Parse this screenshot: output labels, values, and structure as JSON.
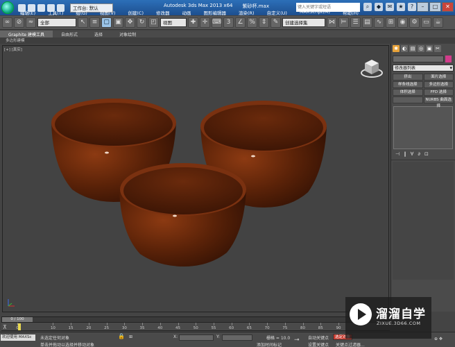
{
  "title": {
    "workspace": "工作台: 默认",
    "app_name": "Autodesk 3ds Max  2013 x64",
    "file_name": "紫砂杯.max",
    "search_placeholder": "键入关键字或短语"
  },
  "menu": [
    "编辑(E)",
    "工具(T)",
    "组(G)",
    "视图(V)",
    "创建(C)",
    "修改器",
    "动画",
    "图形编辑器",
    "渲染(R)",
    "自定义(U)",
    "MAXScript(M)",
    "帮助(H)"
  ],
  "toolbar": {
    "selection_filter": "全部",
    "ref_coord": "视图",
    "named_selection": "创建选择集"
  },
  "ribbon": {
    "tabs": [
      "Graphite 建模工具",
      "自由形式",
      "选择",
      "对象绘制"
    ],
    "sub_label": "多边形建模"
  },
  "viewport": {
    "label": "[+] [真实]"
  },
  "command_panel": {
    "modifier_list": "修改器列表",
    "buttons": [
      "挤出",
      "面片选择",
      "样条线选择",
      "多边形选择",
      "体积选择",
      "FFD 选择",
      "",
      "NURBS 曲面选择"
    ]
  },
  "timeline": {
    "slider": "0 / 100",
    "ticks": [
      "0",
      "10",
      "15",
      "20",
      "25",
      "30",
      "35",
      "40",
      "45",
      "50",
      "55",
      "60",
      "65",
      "70",
      "75",
      "80",
      "85",
      "90"
    ]
  },
  "status": {
    "welcome": "欢迎使用 MAXSc",
    "selection": "未选定任何对象",
    "hint": "单击并拖动以选择并移动对象",
    "x_label": "X:",
    "y_label": "Y:",
    "grid": "栅格 = 10.0",
    "add_time_tag": "添加时间标记",
    "auto_key": "自动关键点",
    "set_key": "设置关键点",
    "selected": "选定对象",
    "key_filter": "关键点过滤器..."
  },
  "watermark": {
    "cn": "溜溜自学",
    "en": "ZIXUE.3D66.COM"
  },
  "colors": {
    "bowl": "#5a2208",
    "bowl_highlight": "#8c3a12",
    "viewport_bg": "#434343"
  }
}
